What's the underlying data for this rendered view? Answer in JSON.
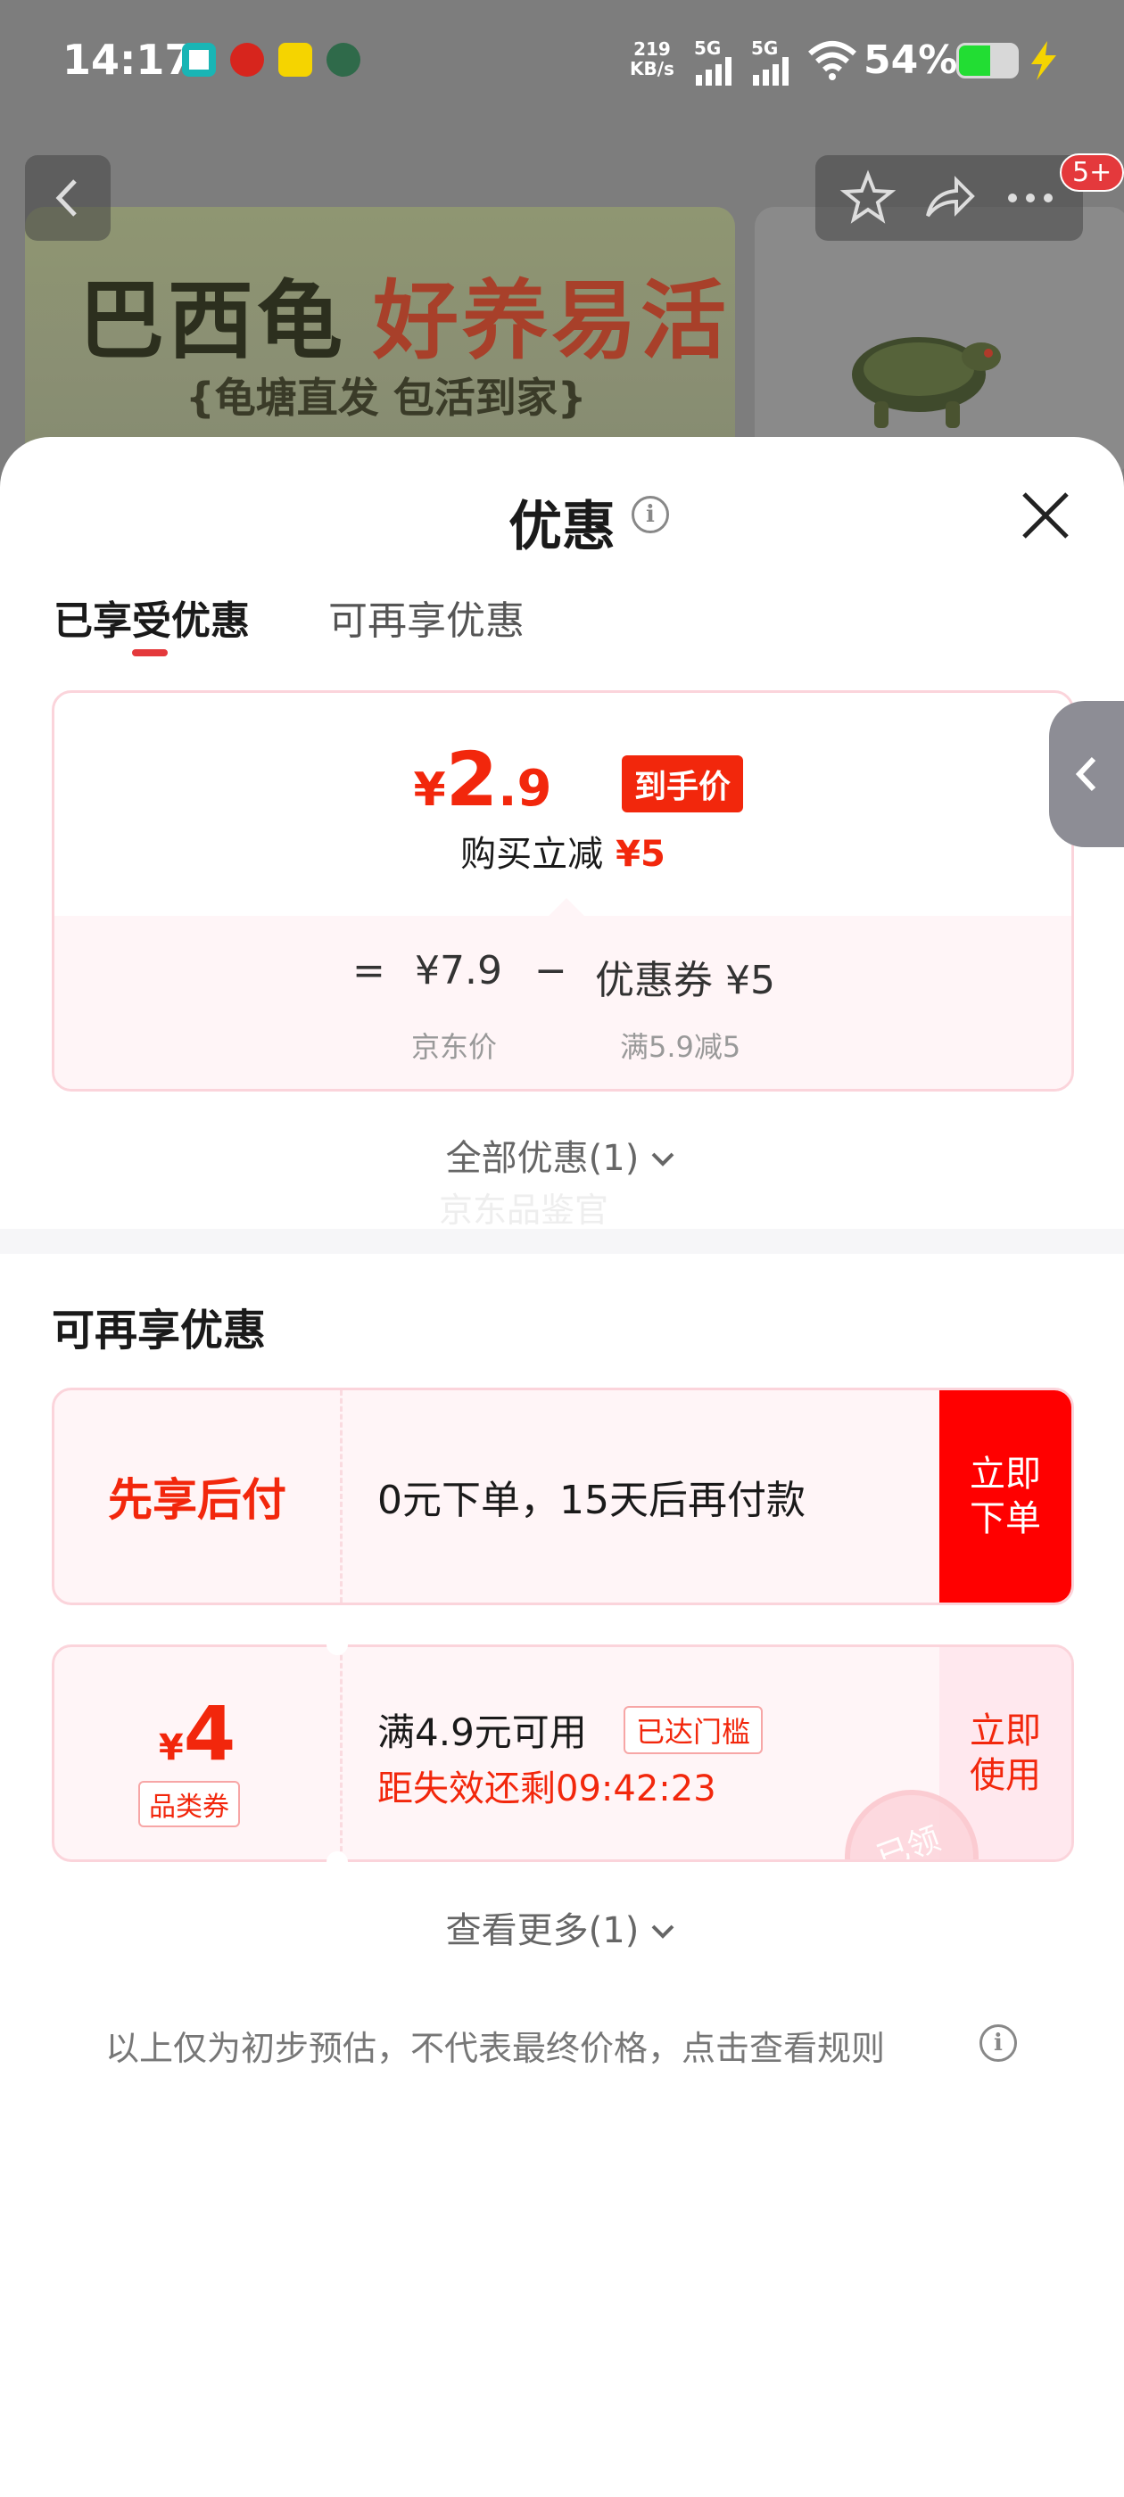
{
  "status_bar": {
    "time": "14:17",
    "net_speed": "219",
    "net_unit": "KB/s",
    "sig1": "5G",
    "sig2": "5G",
    "battery": "54%",
    "battery_level": 0.54
  },
  "background_page": {
    "banner_title_a": "巴西龟",
    "banner_title_b": "好养易活",
    "banner_subtitle": "{龟塘直发 包活到家}",
    "badge": "5+"
  },
  "sheet": {
    "title": "优惠",
    "tabs": [
      {
        "label": "已享受优惠",
        "active": true
      },
      {
        "label": "可再享优惠",
        "active": false
      }
    ]
  },
  "price_card": {
    "currency": "¥",
    "price_int": "2",
    "price_dec": ".9",
    "tag": "到手价",
    "saving_label": "购买立减",
    "saving_amount": "¥5",
    "eq": "=",
    "base_price": "¥7.9",
    "minus": "−",
    "coupon": "优惠券 ¥5",
    "base_label": "京东价",
    "coupon_label": "满5.9减5"
  },
  "all_offers": "全部优惠(1)",
  "watermark": "京东品鉴官",
  "section_title": "可再享优惠",
  "offers": {
    "bnpl": {
      "title": "先享后付",
      "desc": "0元下单，15天后再付款",
      "action": "立即\n下单"
    },
    "coupon": {
      "currency": "¥",
      "amount": "4",
      "category": "品类券",
      "condition": "满4.9元可用",
      "pill": "已达门槛",
      "countdown": "距失效还剩09:42:23",
      "action": "立即\n使用",
      "stamp": "已领"
    }
  },
  "see_more": "查看更多(1)",
  "disclaimer": "以上仅为初步预估，不代表最终价格，点击查看规则",
  "colors": {
    "accent": "#f2270c",
    "action_red": "#ff0000",
    "card_border": "#fbd4db"
  }
}
